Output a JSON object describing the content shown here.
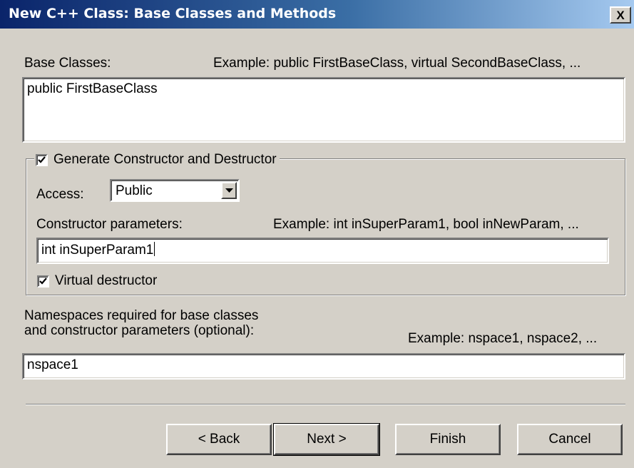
{
  "window": {
    "title": "New C++ Class: Base Classes and Methods",
    "close_label": "X"
  },
  "base_classes": {
    "label": "Base Classes:",
    "example": "Example: public FirstBaseClass, virtual SecondBaseClass, ...",
    "value": "public FirstBaseClass"
  },
  "ctor_group": {
    "checkbox_label": "Generate Constructor and Destructor",
    "checked": true,
    "access_label": "Access:",
    "access_value": "Public",
    "params_label": "Constructor parameters:",
    "params_example": "Example: int inSuperParam1, bool inNewParam, ...",
    "params_value": "int inSuperParam1",
    "virtual_destructor_label": "Virtual destructor",
    "virtual_destructor_checked": true
  },
  "namespaces": {
    "label_line1": "Namespaces required for base classes",
    "label_line2": "and constructor parameters (optional):",
    "example": "Example: nspace1, nspace2, ...",
    "value": "nspace1"
  },
  "buttons": {
    "back": "< Back",
    "next": "Next >",
    "finish": "Finish",
    "cancel": "Cancel"
  }
}
